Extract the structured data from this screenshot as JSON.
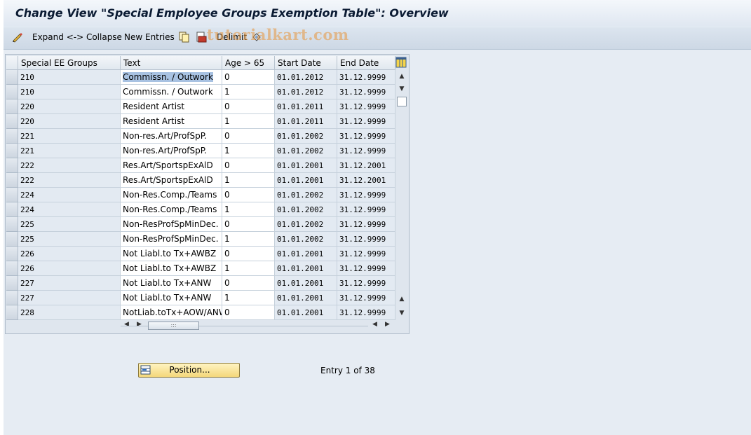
{
  "window": {
    "title": "Change View \"Special Employee Groups Exemption Table\": Overview"
  },
  "toolbar": {
    "expand_collapse_label": "Expand <-> Collapse",
    "new_entries_label": "New Entries",
    "delimit_label": "Delimit",
    "watermark": "tutorialkart.com"
  },
  "table": {
    "columns": [
      "Special EE Groups",
      "Text",
      "Age > 65",
      "Start Date",
      "End Date"
    ],
    "rows": [
      {
        "group": "210",
        "text": "Commissn. / Outwork",
        "age": "0",
        "start": "01.01.2012",
        "end": "31.12.9999"
      },
      {
        "group": "210",
        "text": "Commissn. / Outwork",
        "age": "1",
        "start": "01.01.2012",
        "end": "31.12.9999"
      },
      {
        "group": "220",
        "text": "Resident Artist",
        "age": "0",
        "start": "01.01.2011",
        "end": "31.12.9999"
      },
      {
        "group": "220",
        "text": "Resident Artist",
        "age": "1",
        "start": "01.01.2011",
        "end": "31.12.9999"
      },
      {
        "group": "221",
        "text": "Non-res.Art/ProfSpP.",
        "age": "0",
        "start": "01.01.2002",
        "end": "31.12.9999"
      },
      {
        "group": "221",
        "text": "Non-res.Art/ProfSpP.",
        "age": "1",
        "start": "01.01.2002",
        "end": "31.12.9999"
      },
      {
        "group": "222",
        "text": "Res.Art/SportspExAlD",
        "age": "0",
        "start": "01.01.2001",
        "end": "31.12.2001"
      },
      {
        "group": "222",
        "text": "Res.Art/SportspExAlD",
        "age": "1",
        "start": "01.01.2001",
        "end": "31.12.2001"
      },
      {
        "group": "224",
        "text": "Non-Res.Comp./Teams",
        "age": "0",
        "start": "01.01.2002",
        "end": "31.12.9999"
      },
      {
        "group": "224",
        "text": "Non-Res.Comp./Teams",
        "age": "1",
        "start": "01.01.2002",
        "end": "31.12.9999"
      },
      {
        "group": "225",
        "text": "Non-ResProfSpMinDec.",
        "age": "0",
        "start": "01.01.2002",
        "end": "31.12.9999"
      },
      {
        "group": "225",
        "text": "Non-ResProfSpMinDec.",
        "age": "1",
        "start": "01.01.2002",
        "end": "31.12.9999"
      },
      {
        "group": "226",
        "text": "Not Liabl.to Tx+AWBZ",
        "age": "0",
        "start": "01.01.2001",
        "end": "31.12.9999"
      },
      {
        "group": "226",
        "text": "Not Liabl.to Tx+AWBZ",
        "age": "1",
        "start": "01.01.2001",
        "end": "31.12.9999"
      },
      {
        "group": "227",
        "text": "Not Liabl.to Tx+ANW",
        "age": "0",
        "start": "01.01.2001",
        "end": "31.12.9999"
      },
      {
        "group": "227",
        "text": "Not Liabl.to Tx+ANW",
        "age": "1",
        "start": "01.01.2001",
        "end": "31.12.9999"
      },
      {
        "group": "228",
        "text": "NotLiab.toTx+AOW/ANW",
        "age": "0",
        "start": "01.01.2001",
        "end": "31.12.9999"
      }
    ]
  },
  "footer": {
    "position_label": "Position...",
    "entry_info": "Entry 1 of 38"
  },
  "colors": {
    "accent_button": "#f4d77a",
    "selection_highlight": "#a8c2e2",
    "background": "#e6ecf3"
  }
}
